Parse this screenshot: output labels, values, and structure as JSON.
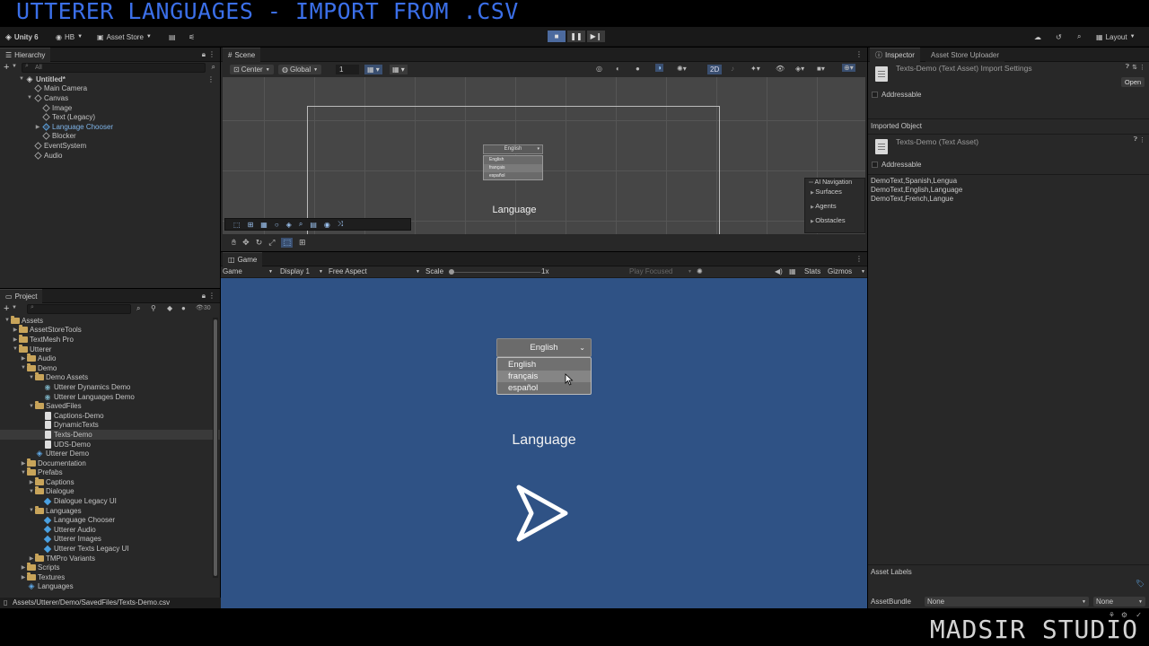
{
  "video_title": "UTTERER LANGUAGES - IMPORT FROM .CSV",
  "watermark": "MADSIR STUDIO",
  "toolbar": {
    "unity": "Unity 6",
    "account": "HB",
    "asset_store": "Asset Store",
    "layout": "Layout"
  },
  "hierarchy": {
    "tab": "Hierarchy",
    "search_placeholder": "All",
    "items": [
      {
        "label": "Untitled*",
        "depth": 0,
        "icon": "unity-scene-icon",
        "arrow": "▼",
        "bold": true
      },
      {
        "label": "Main Camera",
        "depth": 1,
        "icon": "gameobject-icon",
        "arrow": ""
      },
      {
        "label": "Canvas",
        "depth": 1,
        "icon": "gameobject-icon",
        "arrow": "▼"
      },
      {
        "label": "Image",
        "depth": 2,
        "icon": "gameobject-icon",
        "arrow": ""
      },
      {
        "label": "Text (Legacy)",
        "depth": 2,
        "icon": "gameobject-icon",
        "arrow": ""
      },
      {
        "label": "Language Chooser",
        "depth": 2,
        "icon": "prefab-icon",
        "arrow": "▶",
        "blue": true
      },
      {
        "label": "Blocker",
        "depth": 2,
        "icon": "gameobject-icon",
        "arrow": ""
      },
      {
        "label": "EventSystem",
        "depth": 1,
        "icon": "gameobject-icon",
        "arrow": ""
      },
      {
        "label": "Audio",
        "depth": 1,
        "icon": "gameobject-icon",
        "arrow": ""
      }
    ]
  },
  "scene": {
    "tab": "Scene",
    "pivot": "Center",
    "space": "Global",
    "snap_value": "1",
    "mode_2d": "2D",
    "dropdown_selected": "English",
    "dropdown_options": [
      "English",
      "français",
      "español"
    ],
    "label": "Language",
    "ai_nav": {
      "title": "AI Navigation",
      "items": [
        "Surfaces",
        "Agents",
        "Obstacles"
      ]
    }
  },
  "game": {
    "tab": "Game",
    "mode": "Game",
    "display": "Display 1",
    "aspect": "Free Aspect",
    "scale_label": "Scale",
    "scale_value": "1x",
    "play_focused": "Play Focused",
    "stats": "Stats",
    "gizmos": "Gizmos",
    "dropdown_selected": "English",
    "dropdown_options": [
      "English",
      "français",
      "español"
    ],
    "label": "Language"
  },
  "project": {
    "tab": "Project",
    "count": "30",
    "items": [
      {
        "label": "Assets",
        "depth": 0,
        "type": "folder",
        "arrow": "▼"
      },
      {
        "label": "AssetStoreTools",
        "depth": 1,
        "type": "folder",
        "arrow": "▶"
      },
      {
        "label": "TextMesh Pro",
        "depth": 1,
        "type": "folder",
        "arrow": "▶"
      },
      {
        "label": "Utterer",
        "depth": 1,
        "type": "folder",
        "arrow": "▼"
      },
      {
        "label": "Audio",
        "depth": 2,
        "type": "folder",
        "arrow": "▶"
      },
      {
        "label": "Demo",
        "depth": 2,
        "type": "folder",
        "arrow": "▼"
      },
      {
        "label": "Demo Assets",
        "depth": 3,
        "type": "folder",
        "arrow": "▼"
      },
      {
        "label": "Utterer Dynamics Demo",
        "depth": 4,
        "type": "asset",
        "arrow": ""
      },
      {
        "label": "Utterer Languages Demo",
        "depth": 4,
        "type": "asset",
        "arrow": ""
      },
      {
        "label": "SavedFiles",
        "depth": 3,
        "type": "folder",
        "arrow": "▼"
      },
      {
        "label": "Captions-Demo",
        "depth": 4,
        "type": "file",
        "arrow": ""
      },
      {
        "label": "DynamicTexts",
        "depth": 4,
        "type": "file",
        "arrow": ""
      },
      {
        "label": "Texts-Demo",
        "depth": 4,
        "type": "file",
        "arrow": "",
        "selected": true
      },
      {
        "label": "UDS-Demo",
        "depth": 4,
        "type": "file",
        "arrow": ""
      },
      {
        "label": "Utterer Demo",
        "depth": 3,
        "type": "scene",
        "arrow": ""
      },
      {
        "label": "Documentation",
        "depth": 2,
        "type": "folder",
        "arrow": "▶"
      },
      {
        "label": "Prefabs",
        "depth": 2,
        "type": "folder",
        "arrow": "▼"
      },
      {
        "label": "Captions",
        "depth": 3,
        "type": "folder",
        "arrow": "▶"
      },
      {
        "label": "Dialogue",
        "depth": 3,
        "type": "folder",
        "arrow": "▼"
      },
      {
        "label": "Dialogue Legacy UI",
        "depth": 4,
        "type": "prefab",
        "arrow": ""
      },
      {
        "label": "Languages",
        "depth": 3,
        "type": "folder",
        "arrow": "▼"
      },
      {
        "label": "Language Chooser",
        "depth": 4,
        "type": "prefab",
        "arrow": ""
      },
      {
        "label": "Utterer Audio",
        "depth": 4,
        "type": "prefab",
        "arrow": ""
      },
      {
        "label": "Utterer Images",
        "depth": 4,
        "type": "prefab",
        "arrow": ""
      },
      {
        "label": "Utterer Texts Legacy UI",
        "depth": 4,
        "type": "prefab",
        "arrow": ""
      },
      {
        "label": "TMPro Variants",
        "depth": 3,
        "type": "folder",
        "arrow": "▶"
      },
      {
        "label": "Scripts",
        "depth": 2,
        "type": "folder",
        "arrow": "▶"
      },
      {
        "label": "Textures",
        "depth": 2,
        "type": "folder",
        "arrow": "▶"
      },
      {
        "label": "Languages",
        "depth": 2,
        "type": "scene",
        "arrow": ""
      }
    ],
    "status_path": "Assets/Utterer/Demo/SavedFiles/Texts-Demo.csv"
  },
  "inspector": {
    "tab": "Inspector",
    "tab2": "Asset Store Uploader",
    "header_title": "Texts-Demo (Text Asset) Import Settings",
    "open_button": "Open",
    "addressable": "Addressable",
    "imported_object": "Imported Object",
    "object_title": "Texts-Demo (Text Asset)",
    "content_lines": [
      "DemoText,Spanish,Lengua",
      "DemoText,English,Language",
      "DemoText,French,Langue"
    ],
    "asset_labels": "Asset Labels",
    "asset_bundle": "AssetBundle",
    "bundle_value": "None",
    "variant_value": "None"
  }
}
